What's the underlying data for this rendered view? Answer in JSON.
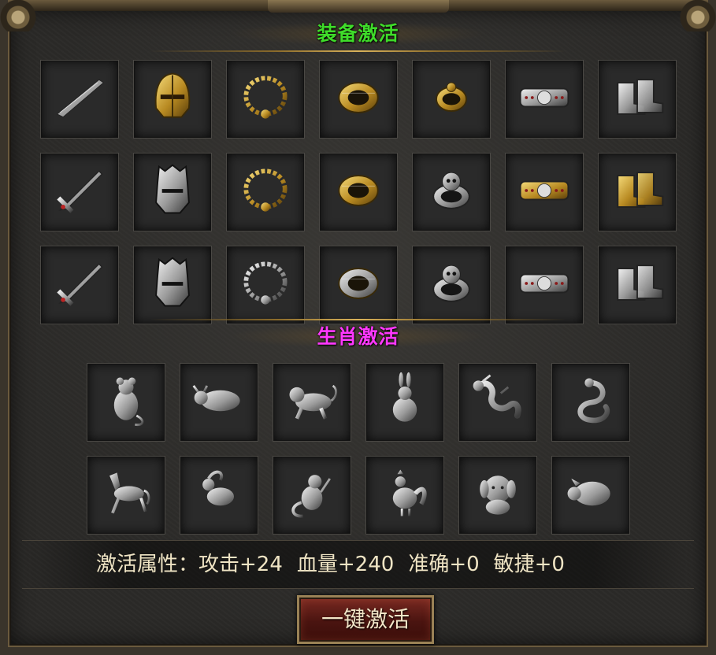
{
  "equipment_section": {
    "title": "装备激活",
    "title_color": "#3fdc2a"
  },
  "equipment_rows": [
    [
      "blade-icon",
      "gold-helmet-icon",
      "gold-necklace-icon",
      "gold-bracelet-icon",
      "gold-ring-icon",
      "studded-belt-icon",
      "silver-boots-icon"
    ],
    [
      "gold-sword-icon",
      "dark-helmet-icon",
      "ornate-necklace-icon",
      "ornate-bracelet-icon",
      "skull-ring-icon",
      "gold-belt-icon",
      "gold-boots-icon"
    ],
    [
      "silver-sword-icon",
      "silver-helmet-icon",
      "silver-necklace-icon",
      "silver-bracelet-icon",
      "silver-ring-icon",
      "silver-belt-icon",
      "silver-boots-icon"
    ]
  ],
  "zodiac_section": {
    "title": "生肖激活",
    "title_color": "#ff38ff"
  },
  "zodiac_rows": [
    [
      "rat-icon",
      "ox-icon",
      "tiger-icon",
      "rabbit-icon",
      "dragon-icon",
      "snake-icon"
    ],
    [
      "horse-icon",
      "goat-icon",
      "monkey-icon",
      "rooster-icon",
      "dog-icon",
      "pig-icon"
    ]
  ],
  "attributes": {
    "label": "激活属性：",
    "items": [
      "攻击+24",
      "血量+240",
      "准确+0",
      "敏捷+0"
    ]
  },
  "activate_button": {
    "label": "一键激活"
  }
}
